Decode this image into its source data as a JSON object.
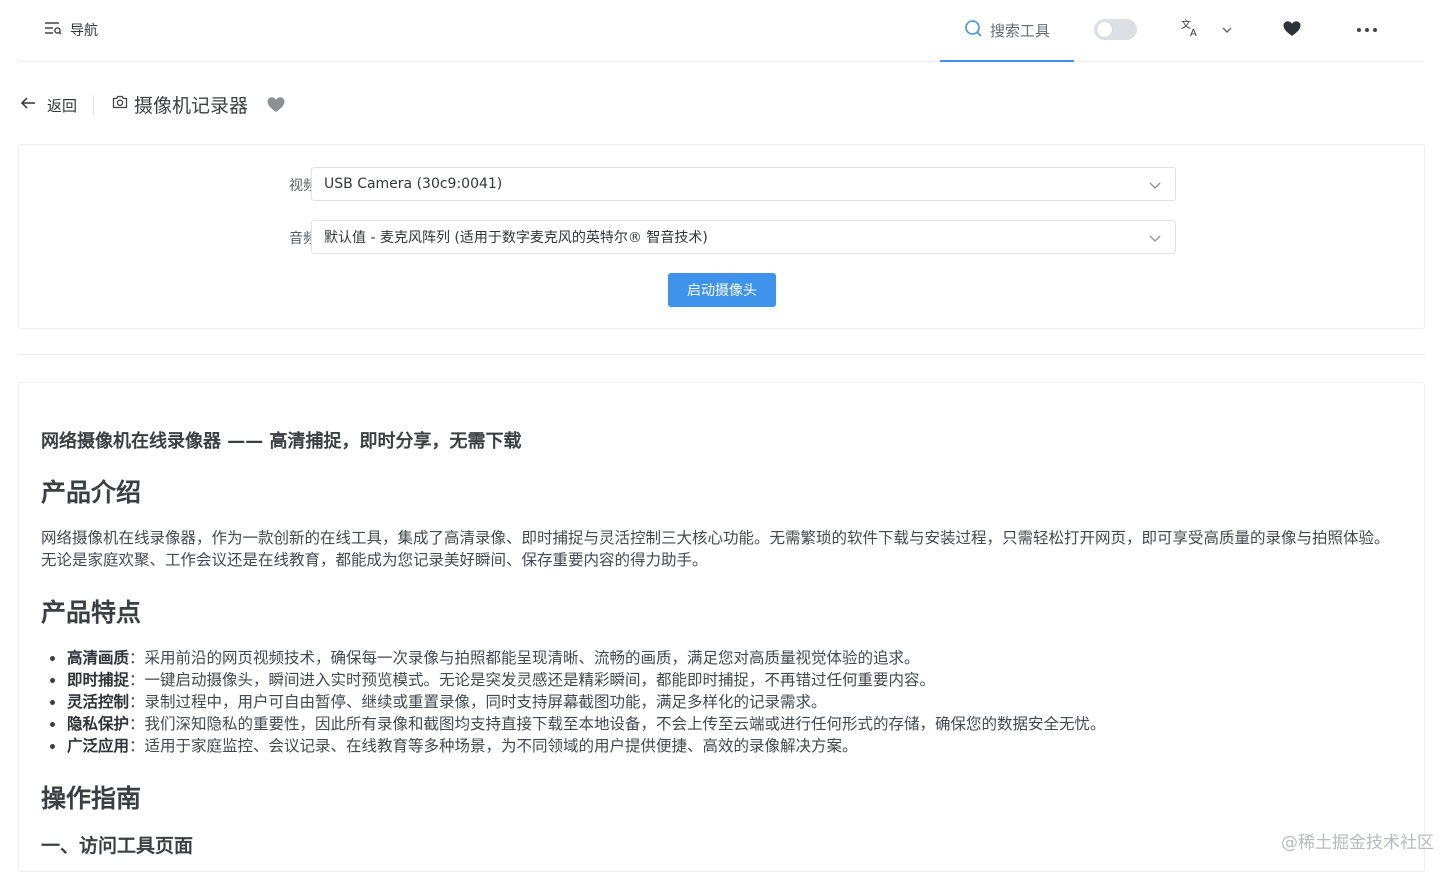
{
  "header": {
    "nav_label": "导航",
    "search_label": "搜索工具",
    "theme_toggle_on": false,
    "active_accent": "#3e93e8"
  },
  "titlebar": {
    "back_label": "返回",
    "tool_title": "摄像机记录器"
  },
  "camera_form": {
    "video_label": "视频",
    "video_value": "USB Camera (30c9:0041)",
    "audio_label": "音频",
    "audio_value": "默认值 - 麦克风阵列 (适用于数字麦克风的英特尔® 智音技术)",
    "start_button": "启动摄像头",
    "button_color": "#3e93ec"
  },
  "article": {
    "subtitle": "网络摄像机在线录像器 —— 高清捕捉，即时分享，无需下载",
    "intro_heading": "产品介绍",
    "intro_text": "网络摄像机在线录像器，作为一款创新的在线工具，集成了高清录像、即时捕捉与灵活控制三大核心功能。无需繁琐的软件下载与安装过程，只需轻松打开网页，即可享受高质量的录像与拍照体验。无论是家庭欢聚、工作会议还是在线教育，都能成为您记录美好瞬间、保存重要内容的得力助手。",
    "features_heading": "产品特点",
    "features": [
      {
        "name": "高清画质",
        "desc": "：采用前沿的网页视频技术，确保每一次录像与拍照都能呈现清晰、流畅的画质，满足您对高质量视觉体验的追求。"
      },
      {
        "name": "即时捕捉",
        "desc": "：一键启动摄像头，瞬间进入实时预览模式。无论是突发灵感还是精彩瞬间，都能即时捕捉，不再错过任何重要内容。"
      },
      {
        "name": "灵活控制",
        "desc": "：录制过程中，用户可自由暂停、继续或重置录像，同时支持屏幕截图功能，满足多样化的记录需求。"
      },
      {
        "name": "隐私保护",
        "desc": "：我们深知隐私的重要性，因此所有录像和截图均支持直接下载至本地设备，不会上传至云端或进行任何形式的存储，确保您的数据安全无忧。"
      },
      {
        "name": "广泛应用",
        "desc": "：适用于家庭监控、会议记录、在线教育等多种场景，为不同领域的用户提供便捷、高效的录像解决方案。"
      }
    ],
    "guide_heading": "操作指南",
    "step1_heading": "一、访问工具页面"
  },
  "watermark": "@稀土掘金技术社区"
}
